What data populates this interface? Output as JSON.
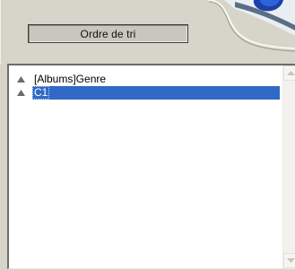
{
  "panel": {
    "title": "Ordre de tri"
  },
  "sort_list": {
    "items": [
      {
        "label": "[Albums]Genre",
        "icon": "sort-ascending-icon",
        "selected": false
      },
      {
        "label": "C1",
        "icon": "sort-ascending-icon",
        "selected": true
      }
    ]
  },
  "colors": {
    "panel_grey": "#d7d4c9",
    "selection": "#3169c6",
    "list_background": "#ffffff"
  }
}
